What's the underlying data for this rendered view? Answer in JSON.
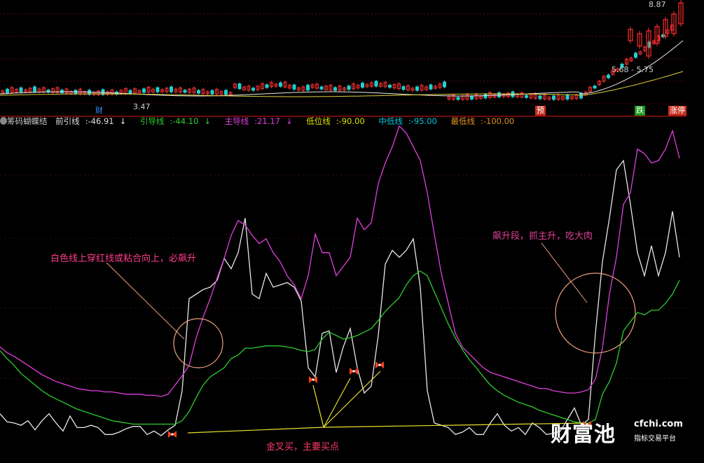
{
  "chart_data": [
    {
      "type": "candlestick",
      "title": "",
      "price_labels": {
        "high": "8.87",
        "low": "3.47",
        "range": "5.68 - 5.75"
      },
      "event_tags": [
        {
          "text": "财",
          "color": "#3c8cff"
        },
        {
          "text": "预",
          "color": "#ff5a3c"
        },
        {
          "text": "跌",
          "color": "#2ecc2e"
        },
        {
          "text": "涨停",
          "color": "#ff5a3c"
        }
      ]
    },
    {
      "type": "line",
      "title": "筹码蝴蝶结",
      "legend": [
        {
          "name": "前引线",
          "value": "-46.91",
          "arrow": "↓",
          "color": "#e0e0e0"
        },
        {
          "name": "引导线",
          "value": "-44.10",
          "arrow": "↓",
          "color": "#2ecc2e"
        },
        {
          "name": "主导线",
          "value": "21.17",
          "arrow": "↓",
          "color": "#e040e0"
        },
        {
          "name": "低位线",
          "value": "-90.00",
          "arrow": "",
          "color": "#e0e000"
        },
        {
          "name": "中低线",
          "value": "-95.00",
          "arrow": "",
          "color": "#00c8e0"
        },
        {
          "name": "最低线",
          "value": "-100.00",
          "arrow": "",
          "color": "#e09020"
        }
      ],
      "ylim": [
        -110,
        170
      ],
      "x": [
        0,
        10,
        20,
        30,
        40,
        50,
        60,
        70,
        80,
        90,
        100,
        110,
        120,
        130,
        140,
        150,
        160,
        170,
        180,
        190,
        200,
        210,
        220,
        230,
        240,
        250,
        260,
        270,
        280,
        290,
        300,
        310,
        320,
        330,
        340,
        350,
        360,
        370,
        380,
        390,
        400,
        410,
        420,
        430,
        440,
        450,
        460,
        470,
        480,
        490,
        500,
        510,
        520,
        530,
        540,
        550,
        560,
        570,
        580,
        590,
        600,
        610,
        620,
        630,
        640,
        650,
        660,
        670,
        680,
        690,
        700,
        710,
        720,
        730,
        740,
        750,
        760,
        770,
        780,
        790,
        800,
        810,
        820,
        830,
        840,
        850,
        860,
        870,
        880,
        890,
        900,
        910,
        920,
        930,
        940,
        950,
        960,
        970
      ],
      "series": [
        {
          "name": "前引线",
          "color": "#e8e8e8",
          "values": [
            -80,
            -87,
            -88,
            -90,
            -86,
            -94,
            -86,
            -80,
            -88,
            -95,
            -82,
            -92,
            -92,
            -90,
            -92,
            -98,
            -98,
            -96,
            -93,
            -91,
            -91,
            -98,
            -95,
            -99,
            -94,
            -90,
            -60,
            20,
            24,
            28,
            30,
            36,
            55,
            46,
            60,
            90,
            24,
            20,
            42,
            30,
            32,
            34,
            30,
            18,
            -40,
            -48,
            -10,
            -8,
            -44,
            -22,
            -6,
            -40,
            -62,
            -56,
            -12,
            50,
            62,
            56,
            62,
            72,
            30,
            -60,
            -88,
            -90,
            -92,
            -98,
            -96,
            -92,
            -98,
            -98,
            -88,
            -80,
            -90,
            -95,
            -92,
            -98,
            -88,
            -92,
            -98,
            -97,
            -95,
            -85,
            -75,
            -90,
            -85,
            -10,
            52,
            90,
            132,
            140,
            102,
            60,
            40,
            66,
            40,
            60,
            96,
            56
          ]
        },
        {
          "name": "引导线",
          "color": "#2ecc2e",
          "values": [
            -25,
            -32,
            -38,
            -45,
            -50,
            -55,
            -60,
            -64,
            -67,
            -70,
            -73,
            -76,
            -78,
            -80,
            -82,
            -84,
            -86,
            -87,
            -88,
            -89,
            -89,
            -89,
            -89,
            -89,
            -89,
            -89,
            -86,
            -78,
            -66,
            -55,
            -48,
            -44,
            -40,
            -32,
            -29,
            -23,
            -23,
            -22,
            -21,
            -21,
            -21,
            -22,
            -23,
            -25,
            -26,
            -24,
            -15,
            -9,
            -12,
            -15,
            -14,
            -12,
            -9,
            -6,
            1,
            9,
            15,
            21,
            32,
            40,
            44,
            40,
            26,
            12,
            -2,
            -14,
            -24,
            -33,
            -40,
            -48,
            -55,
            -60,
            -64,
            -67,
            -70,
            -72,
            -74,
            -77,
            -79,
            -81,
            -83,
            -85,
            -87,
            -88,
            -88,
            -85,
            -63,
            -52,
            -36,
            -8,
            0,
            8,
            6,
            10,
            10,
            16,
            24,
            36
          ]
        },
        {
          "name": "主导线",
          "color": "#e040e0",
          "values": [
            -22,
            -27,
            -30,
            -34,
            -38,
            -42,
            -46,
            -49,
            -52,
            -54,
            -56,
            -58,
            -59,
            -60,
            -60,
            -61,
            -61,
            -62,
            -63,
            -63,
            -63,
            -64,
            -64,
            -65,
            -63,
            -55,
            -47,
            -38,
            -14,
            4,
            20,
            38,
            55,
            75,
            88,
            84,
            75,
            68,
            72,
            60,
            52,
            40,
            32,
            20,
            40,
            76,
            60,
            60,
            40,
            48,
            56,
            90,
            80,
            86,
            120,
            138,
            152,
            170,
            164,
            152,
            140,
            112,
            76,
            42,
            16,
            -10,
            -22,
            -28,
            -34,
            -40,
            -44,
            -46,
            -48,
            -50,
            -52,
            -54,
            -56,
            -58,
            -58,
            -60,
            -61,
            -62,
            -62,
            -61,
            -59,
            -50,
            -23,
            24,
            56,
            102,
            112,
            150,
            146,
            138,
            140,
            150,
            166,
            142
          ]
        },
        {
          "name": "低位线",
          "color": "#e0e000",
          "values": [
            -90,
            -90,
            -90,
            -90,
            -90,
            -90,
            -90,
            -90,
            -90,
            -90,
            -90,
            -90,
            -90,
            -90,
            -90,
            -90,
            -90,
            -90,
            -90,
            -90,
            -90,
            -90,
            -90,
            -90,
            -90,
            -90,
            -90,
            -90,
            -90,
            -90,
            -90,
            -90,
            -90,
            -90,
            -90,
            -90,
            -90,
            -90,
            -90,
            -90,
            -90,
            -90,
            -90,
            -90,
            -90,
            -90,
            -90,
            -90,
            -90,
            -90,
            -90,
            -90,
            -90,
            -90,
            -90,
            -90,
            -90,
            -90,
            -90,
            -90,
            -90,
            -90,
            -90,
            -90,
            -90,
            -90,
            -90,
            -90,
            -90,
            -90,
            -90,
            -90,
            -90,
            -90,
            -90,
            -90,
            -90,
            -90,
            -90,
            -90,
            -90,
            -90,
            -90,
            -90,
            -90,
            -90,
            -90,
            -90,
            -90,
            -90,
            -90,
            -90,
            -90,
            -90,
            -90,
            -90,
            -90,
            -90
          ]
        }
      ],
      "annotations": {
        "left": "白色线上穿红线或粘合向上，必飙升",
        "right": "飙升段，抓主升，吃大肉",
        "bottom": "金叉买，主要买点"
      }
    }
  ],
  "watermark": {
    "brand": "财富池",
    "url": "cfchi.com",
    "sub": "指标交易平台"
  }
}
